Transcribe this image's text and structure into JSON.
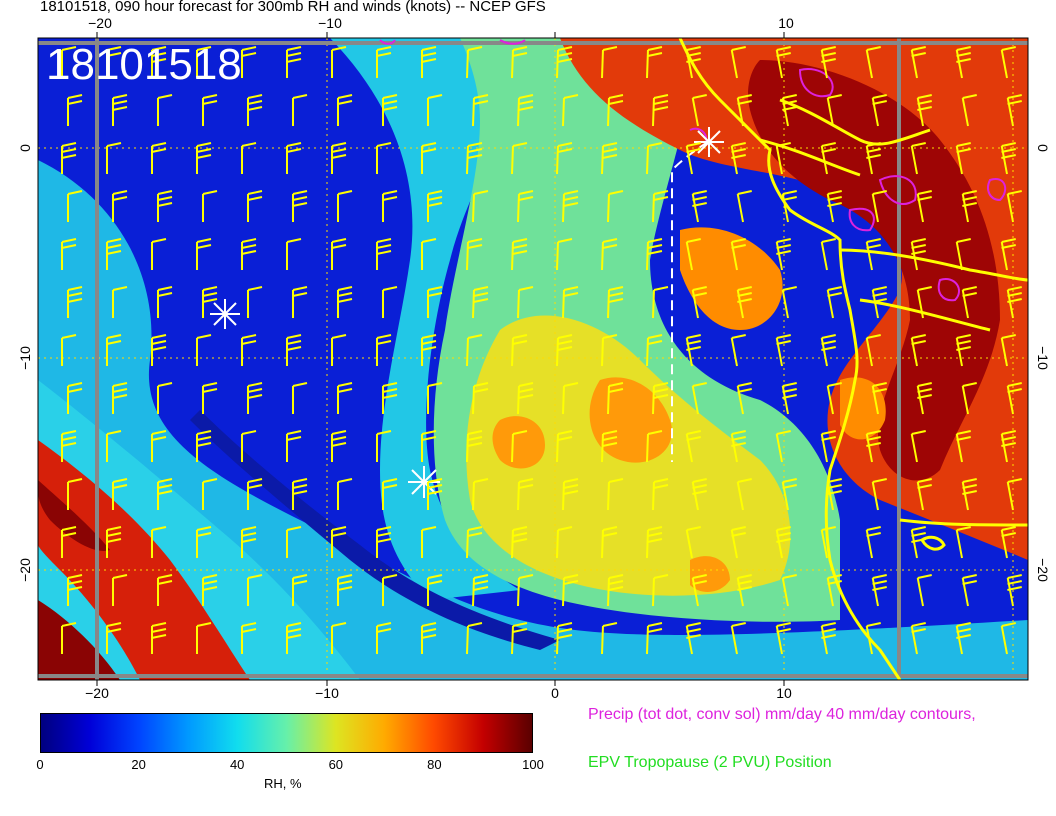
{
  "header": {
    "title": "18101518, 090 hour forecast for 300mb RH and winds (knots) -- NCEP GFS"
  },
  "map": {
    "stamp": "18101518",
    "x_ticks": [
      "−20",
      "−10",
      "0",
      "10"
    ],
    "y_ticks": [
      "0",
      "−10",
      "−20"
    ],
    "colors": {
      "dry": "#00007f",
      "moist": "#5a0000",
      "coast": "#ffff00",
      "barbs": "#ffff00",
      "precip_contour": "#dd22dd",
      "epv": "#22dd22"
    }
  },
  "colorbar": {
    "ticks": [
      "0",
      "20",
      "40",
      "60",
      "80",
      "100"
    ],
    "label": "RH, %"
  },
  "legend": {
    "precip": "Precip (tot dot, conv sol) mm/day 40 mm/day contours,",
    "epv": "EPV Tropopause (2 PVU) Position"
  }
}
